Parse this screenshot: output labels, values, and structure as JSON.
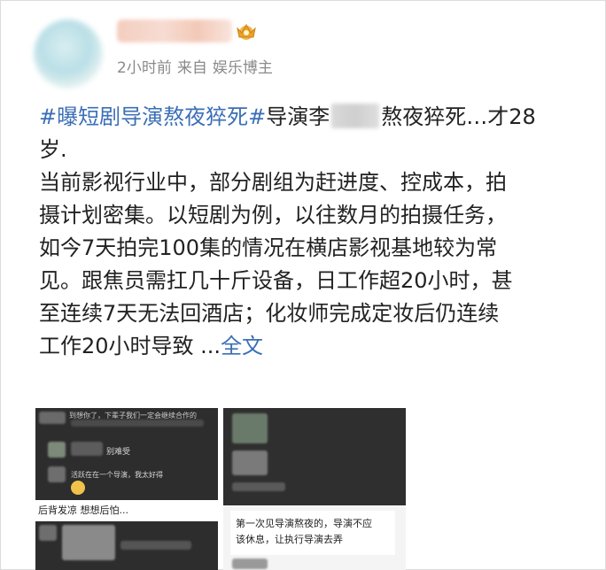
{
  "header": {
    "time": "2小时前",
    "source_prefix": "来自",
    "source": "娱乐博主"
  },
  "post": {
    "hashtag": "#曝短剧导演熬夜猝死#",
    "line1_a": "导演李",
    "line1_b": "熬夜猝死…才28",
    "line2": "岁.",
    "line3": "当前影视行业中，部分剧组为赶进度、控成本，拍",
    "line4": "摄计划密集。以短剧为例，以往数月的拍摄任务，",
    "line5": "如今7天拍完100集的情况在横店影视基地较为常",
    "line6": "见。跟焦员需扛几十斤设备，日工作超20小时，甚",
    "line7": "至连续7天无法回酒店；化妆师完成定妆后仍连续",
    "line8": "工作20小时导致 ...",
    "full_text_link": "全文"
  },
  "images": {
    "left": {
      "chat_top": "到想你了，下辈子我们一定会继续合作的",
      "reply1": "别难受",
      "reply2": "活跃在在一个导演，我太好得",
      "caption": "后背发凉 想想后怕..."
    },
    "right": {
      "note_line1": "第一次见导演熬夜的，导演不应",
      "note_line2": "该休息，让执行导演去弄"
    }
  },
  "colors": {
    "link": "#3b6fb6",
    "meta": "#8a8a8a",
    "text": "#222222"
  }
}
